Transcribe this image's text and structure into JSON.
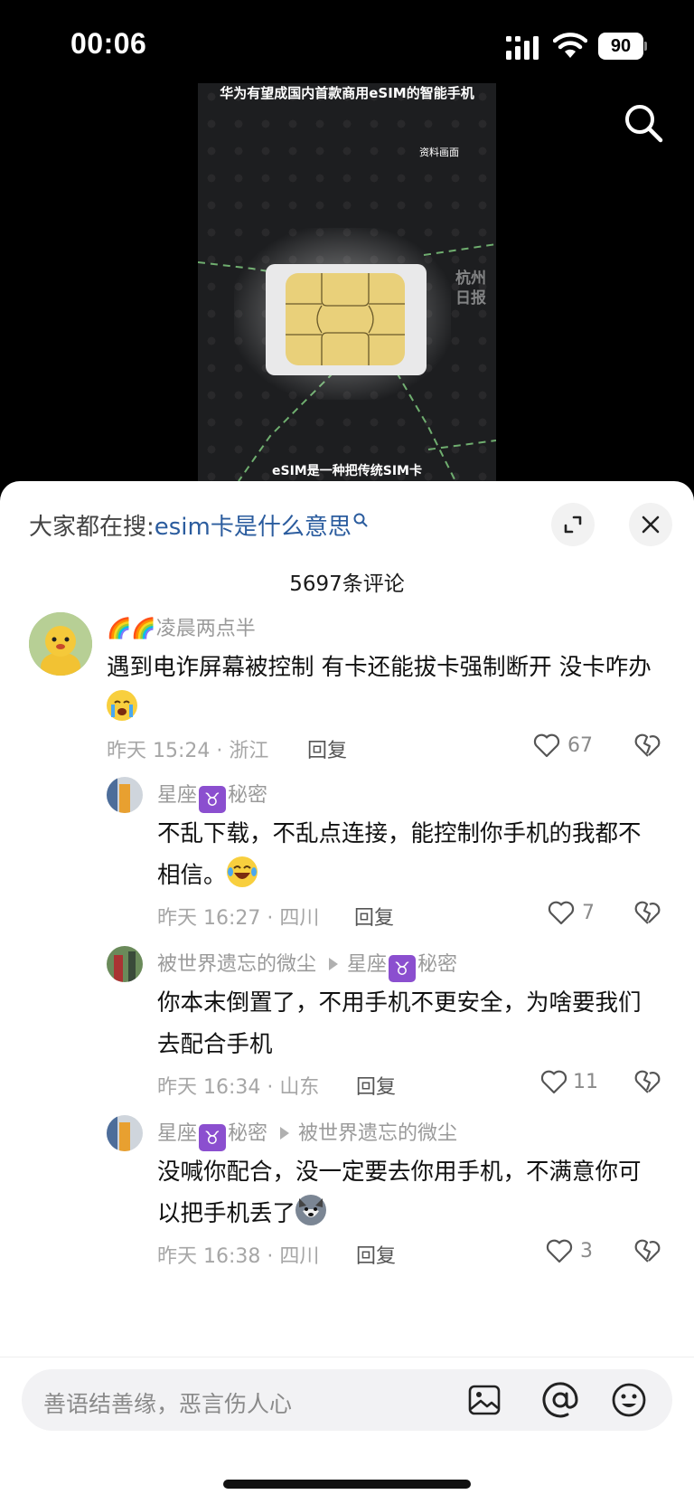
{
  "status_bar": {
    "time": "00:06",
    "battery": "90"
  },
  "video": {
    "title": "华为有望成国内首款商用eSIM的智能手机",
    "tag": "资料画面",
    "caption": "eSIM是一种把传统SIM卡",
    "watermark": "杭州日报"
  },
  "sheet": {
    "search_prefix": "大家都在搜:",
    "search_term": "esim卡是什么意思",
    "comment_count": "5697条评论"
  },
  "comments": [
    {
      "user": "🌈🌈凌晨两点半",
      "text": "遇到电诈屏幕被控制 有卡还能拔卡强制断开 没卡咋办",
      "time_location": "昨天 15:24 · 浙江",
      "reply_label": "回复",
      "likes": "67"
    },
    {
      "user_prefix": "星座",
      "user_badge": "♉",
      "user_suffix": "秘密",
      "text": "不乱下载，不乱点连接，能控制你手机的我都不相信。",
      "time_location": "昨天 16:27 · 四川",
      "reply_label": "回复",
      "likes": "7"
    },
    {
      "user": "被世界遗忘的微尘",
      "reply_to_prefix": "星座",
      "reply_to_badge": "♉",
      "reply_to_suffix": "秘密",
      "text": "你本末倒置了，不用手机不更安全，为啥要我们去配合手机",
      "time_location": "昨天 16:34 · 山东",
      "reply_label": "回复",
      "likes": "11"
    },
    {
      "user_prefix": "星座",
      "user_badge": "♉",
      "user_suffix": "秘密",
      "reply_to": "被世界遗忘的微尘",
      "text": "没喊你配合，没一定要去你用手机，不满意你可以把手机丢了",
      "time_location": "昨天 16:38 · 四川",
      "reply_label": "回复",
      "likes": "3"
    }
  ],
  "input": {
    "placeholder": "善语结善缘，恶言伤人心"
  },
  "colors": {
    "accent_link": "#2b5c9e",
    "badge_purple": "#8b4fcf"
  }
}
